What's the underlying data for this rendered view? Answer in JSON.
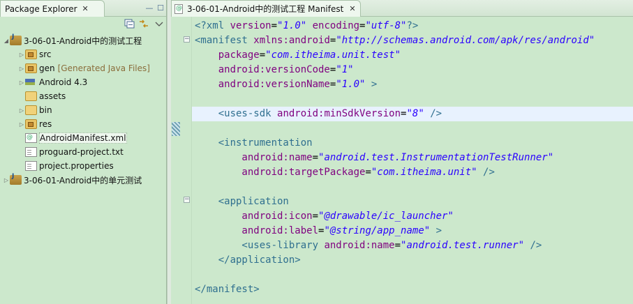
{
  "explorer": {
    "tab_label": "Package Explorer",
    "close_glyph": "✕",
    "minimize_glyph": "—",
    "maximize_glyph": "☐",
    "collapse_icon": "collapse-all-icon",
    "link_icon": "link-with-editor-icon",
    "menu_icon": "view-menu-icon",
    "tree": [
      {
        "label": "3-06-01-Android中的测试工程",
        "icon": "project-icon",
        "expanded": true
      },
      {
        "label": "src",
        "icon": "package-folder-icon"
      },
      {
        "label": "gen",
        "decoration": "[Generated Java Files]",
        "icon": "package-folder-icon"
      },
      {
        "label": "Android 4.3",
        "icon": "library-icon"
      },
      {
        "label": "assets",
        "icon": "folder-icon"
      },
      {
        "label": "bin",
        "icon": "folder-icon"
      },
      {
        "label": "res",
        "icon": "package-folder-icon"
      },
      {
        "label": "AndroidManifest.xml",
        "icon": "xml-file-icon",
        "selected": true
      },
      {
        "label": "proguard-project.txt",
        "icon": "text-file-icon"
      },
      {
        "label": "project.properties",
        "icon": "text-file-icon"
      },
      {
        "label": "3-06-01-Android中的单元测试",
        "icon": "project-icon",
        "expanded": false
      }
    ]
  },
  "editor": {
    "tab_label": "3-06-01-Android中的测试工程 Manifest",
    "close_glyph": "✕",
    "lines": [
      [
        [
          "t",
          "<?xml "
        ],
        [
          "a",
          "version"
        ],
        [
          "e",
          "="
        ],
        [
          "v",
          "\"1.0\""
        ],
        [
          "a",
          " encoding"
        ],
        [
          "e",
          "="
        ],
        [
          "v",
          "\"utf-8\""
        ],
        [
          "t",
          "?>"
        ]
      ],
      [
        [
          "t",
          "<manifest "
        ],
        [
          "a",
          "xmlns:android"
        ],
        [
          "e",
          "="
        ],
        [
          "v",
          "\"http://schemas.android.com/apk/res/android\""
        ]
      ],
      [
        [
          "a",
          "    package"
        ],
        [
          "e",
          "="
        ],
        [
          "v",
          "\"com.itheima.unit.test\""
        ]
      ],
      [
        [
          "a",
          "    android:versionCode"
        ],
        [
          "e",
          "="
        ],
        [
          "v",
          "\"1\""
        ]
      ],
      [
        [
          "a",
          "    android:versionName"
        ],
        [
          "e",
          "="
        ],
        [
          "v",
          "\"1.0\""
        ],
        [
          "t",
          " >"
        ]
      ],
      [],
      [
        [
          "t",
          "    <uses-sdk "
        ],
        [
          "a",
          "android:minSdkVersion"
        ],
        [
          "e",
          "="
        ],
        [
          "v",
          "\"8\""
        ],
        [
          "t",
          " />"
        ]
      ],
      [],
      [
        [
          "t",
          "    <instrumentation"
        ]
      ],
      [
        [
          "a",
          "        android:name"
        ],
        [
          "e",
          "="
        ],
        [
          "v",
          "\"android.test.InstrumentationTestRunner\""
        ]
      ],
      [
        [
          "a",
          "        android:targetPackage"
        ],
        [
          "e",
          "="
        ],
        [
          "v",
          "\"com.itheima.unit\""
        ],
        [
          "t",
          " />"
        ]
      ],
      [],
      [
        [
          "t",
          "    <application"
        ]
      ],
      [
        [
          "a",
          "        android:icon"
        ],
        [
          "e",
          "="
        ],
        [
          "v",
          "\"@drawable/ic_launcher\""
        ]
      ],
      [
        [
          "a",
          "        android:label"
        ],
        [
          "e",
          "="
        ],
        [
          "v",
          "\"@string/app_name\""
        ],
        [
          "t",
          " >"
        ]
      ],
      [
        [
          "t",
          "        <uses-library "
        ],
        [
          "a",
          "android:name"
        ],
        [
          "e",
          "="
        ],
        [
          "v",
          "\"android.test.runner\""
        ],
        [
          "t",
          " />"
        ]
      ],
      [
        [
          "t",
          "    </application>"
        ]
      ],
      [],
      [
        [
          "t",
          "</manifest>"
        ]
      ]
    ],
    "highlighted_line": 6,
    "fold_lines": [
      1,
      12
    ]
  }
}
